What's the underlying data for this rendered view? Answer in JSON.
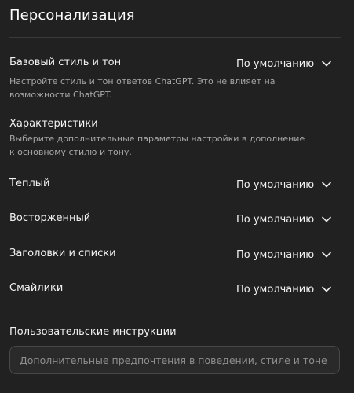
{
  "header": {
    "title": "Персонализация"
  },
  "base_style": {
    "label": "Базовый стиль и тон",
    "description": "Настройте стиль и тон ответов ChatGPT. Это не влияет на возможности ChatGPT.",
    "value": "По умолчанию",
    "icon": "chevron-down-icon"
  },
  "characteristics": {
    "heading": "Характеристики",
    "description": "Выберите дополнительные параметры настройки в дополнение к основному стилю и тону.",
    "items": [
      {
        "label": "Теплый",
        "value": "По умолчанию"
      },
      {
        "label": "Восторженный",
        "value": "По умолчанию"
      },
      {
        "label": "Заголовки и списки",
        "value": "По умолчанию"
      },
      {
        "label": "Смайлики",
        "value": "По умолчанию"
      }
    ]
  },
  "custom_instructions": {
    "label": "Пользовательские инструкции",
    "value": "",
    "placeholder": "Дополнительные предпочтения в поведении, стиле и тоне"
  },
  "colors": {
    "background": "#212121",
    "text": "#f2f2f2",
    "muted": "#a8a8a8",
    "border": "#484848"
  }
}
